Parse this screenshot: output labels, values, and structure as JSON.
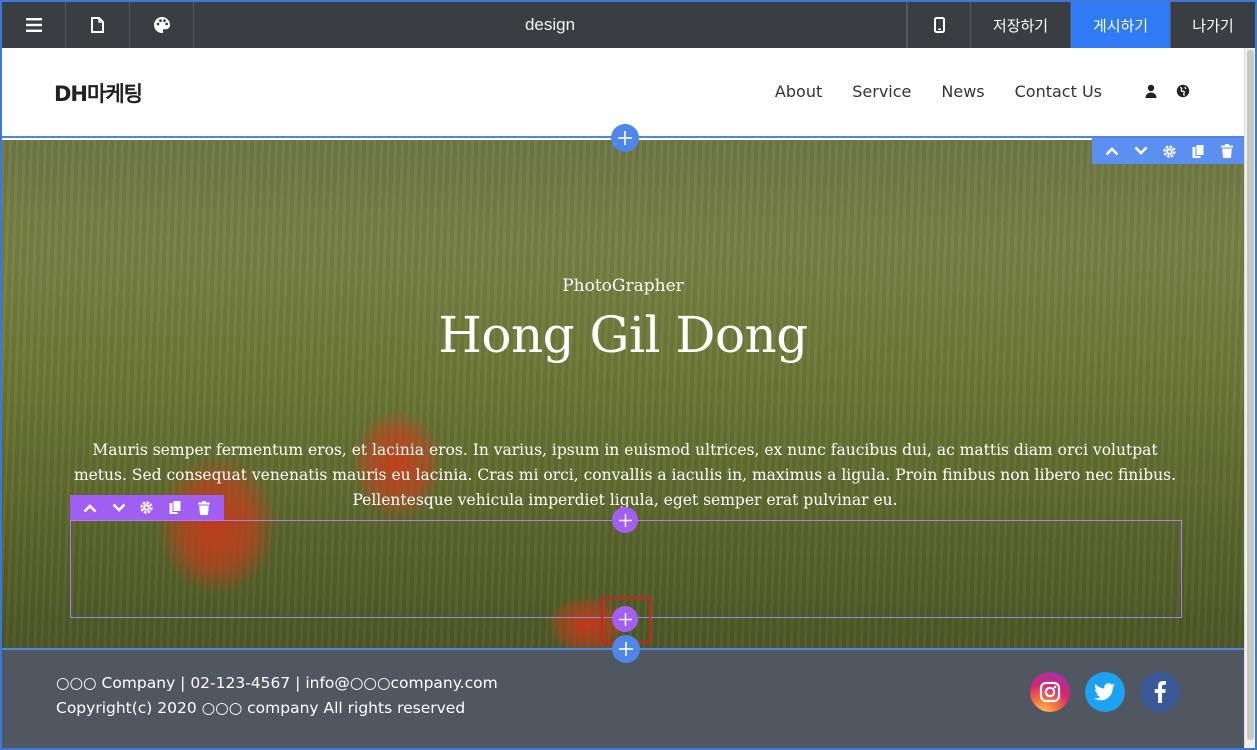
{
  "toolbar": {
    "title": "design",
    "save_label": "저장하기",
    "publish_label": "게시하기",
    "exit_label": "나가기",
    "colors": {
      "bar": "#3a3d42",
      "publish": "#2f7bf5"
    }
  },
  "site": {
    "logo": "DH마케팅",
    "nav": [
      "About",
      "Service",
      "News",
      "Contact Us"
    ],
    "nav_icons": [
      "user-icon",
      "globe-icon"
    ]
  },
  "hero": {
    "subtitle": "PhotoGrapher",
    "title": "Hong Gil Dong",
    "body": "Mauris semper fermentum eros, et lacinia eros. In varius, ipsum in euismod ultrices, ex nunc faucibus dui, ac mattis diam orci volutpat metus. Sed consequat venenatis mauris eu lacinia. Cras mi orci, convallis a iaculis in, maximus a ligula. Proin finibus non libero nec finibus. Pellentesque vehicula imperdiet ligula, eget semper erat pulvinar eu."
  },
  "editor": {
    "section_tools": [
      "move-up-icon",
      "move-down-icon",
      "settings-icon",
      "copy-icon",
      "delete-icon"
    ],
    "block_tools": [
      "move-up-icon",
      "move-down-icon",
      "settings-icon",
      "copy-icon",
      "delete-icon"
    ],
    "colors": {
      "section": "#5b8ff0",
      "block": "#a15ef2",
      "highlight": "#d41f1f"
    }
  },
  "footer": {
    "line1": "○○○ Company | 02-123-4567 | info@○○○company.com",
    "line2": "Copyright(c) 2020 ○○○ company All rights reserved",
    "social": [
      "instagram-icon",
      "twitter-icon",
      "facebook-icon"
    ],
    "background": "#515760"
  }
}
